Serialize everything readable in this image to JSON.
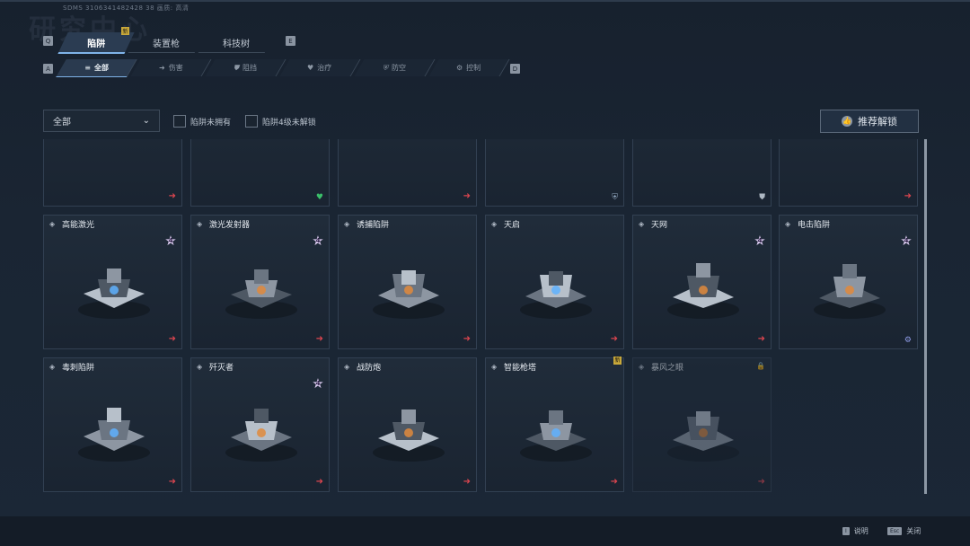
{
  "header": {
    "build": "SDMS  3106341482428 38          画质:  高清",
    "bg_title": "研究中心"
  },
  "keys": {
    "prev": "Q",
    "next": "E",
    "sub_prev": "A",
    "sub_next": "D"
  },
  "tabs": [
    {
      "label": "陷阱",
      "active": true,
      "badge": "新"
    },
    {
      "label": "装置枪"
    },
    {
      "label": "科技树"
    }
  ],
  "subtabs": [
    {
      "label": "全部",
      "icon": "≡",
      "active": true
    },
    {
      "label": "伤害",
      "icon": "➜"
    },
    {
      "label": "阻挡",
      "icon": "⛊"
    },
    {
      "label": "治疗",
      "icon": "♥"
    },
    {
      "label": "防空",
      "icon": "⛨"
    },
    {
      "label": "控制",
      "icon": "⚙"
    }
  ],
  "filter": {
    "dropdown": "全部",
    "chk1": "陷阱未拥有",
    "chk2": "陷阱4级未解锁",
    "recommend": "推荐解锁"
  },
  "rows": [
    [
      {
        "name": "",
        "mark": "arrow"
      },
      {
        "name": "",
        "mark": "heal"
      },
      {
        "name": "",
        "mark": "arrow"
      },
      {
        "name": "",
        "mark": "air"
      },
      {
        "name": "",
        "mark": "block"
      },
      {
        "name": "",
        "mark": "arrow"
      }
    ],
    [
      {
        "name": "高能激光",
        "star": "4",
        "mark": "arrow"
      },
      {
        "name": "激光发射器",
        "star": "4",
        "mark": "arrow"
      },
      {
        "name": "诱捕陷阱",
        "mark": "arrow"
      },
      {
        "name": "天启",
        "mark": "arrow"
      },
      {
        "name": "天网",
        "star": "4",
        "mark": "arrow"
      },
      {
        "name": "电击陷阱",
        "star": "4",
        "mark": "control"
      }
    ],
    [
      {
        "name": "毒刺陷阱",
        "mark": "arrow"
      },
      {
        "name": "歼灭者",
        "star": "4",
        "mark": "arrow"
      },
      {
        "name": "战防炮",
        "mark": "arrow"
      },
      {
        "name": "智能枪塔",
        "mark": "arrow",
        "new": "新"
      },
      {
        "name": "暴风之眼",
        "mark": "arrow",
        "locked": true
      }
    ]
  ],
  "hints": {
    "help_key": "I",
    "help": "说明",
    "close_key": "Esc",
    "close": "关闭"
  },
  "colors": {
    "accent": "#7fb3e8",
    "arrow": "#d9454f",
    "heal": "#3bbf6a",
    "star": "#d9c9ee",
    "gold": "#c9a93a"
  }
}
